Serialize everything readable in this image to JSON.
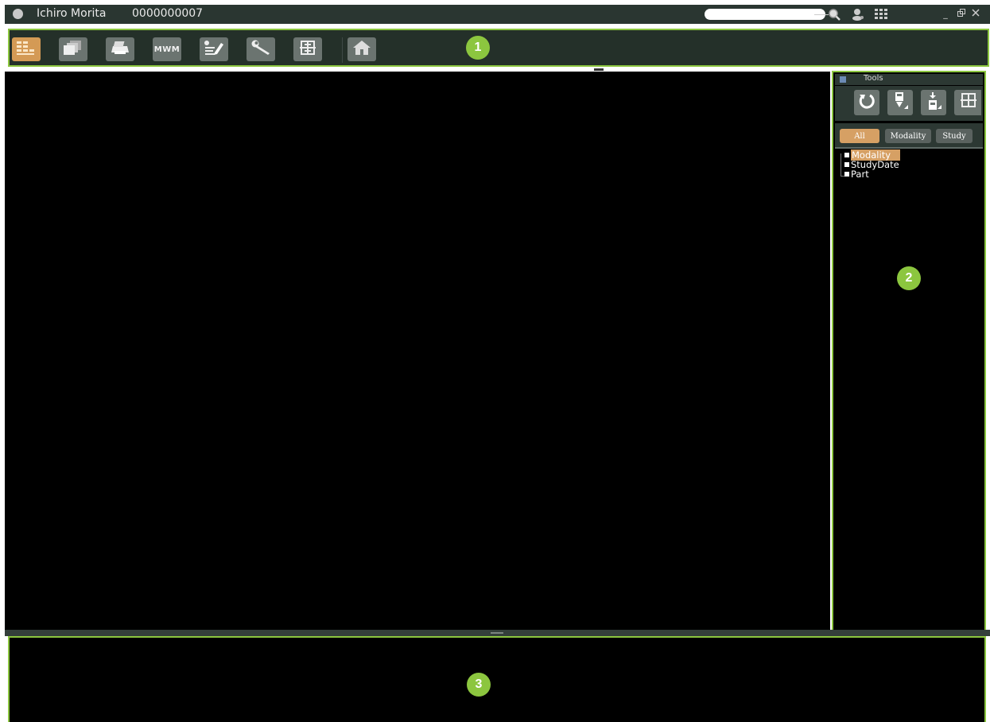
{
  "titlebar": {
    "patient_name": "Ichiro Morita",
    "patient_id": "0000000007",
    "search_value": "",
    "icons": [
      "avatar-icon",
      "search-icon",
      "user-search-icon",
      "grid-icon",
      "minimize-icon",
      "restore-icon",
      "close-icon"
    ]
  },
  "toolbar": {
    "buttons": [
      {
        "name": "thumbnail-view-button",
        "icon": "grid-icon",
        "active": true
      },
      {
        "name": "series-view-button",
        "icon": "stack-icon"
      },
      {
        "name": "print-button",
        "icon": "printer-icon"
      },
      {
        "name": "mwm-button",
        "label": "MWM"
      },
      {
        "name": "report-button",
        "icon": "edit-notes-icon"
      },
      {
        "name": "settings-button",
        "icon": "wrench-icon"
      },
      {
        "name": "layout-button",
        "icon": "layout-icon"
      },
      {
        "name": "home-button",
        "icon": "home-icon"
      }
    ]
  },
  "callouts": {
    "c1": "1",
    "c2": "2",
    "c3": "3"
  },
  "tools_panel": {
    "title": "Tools",
    "tool_icons": [
      "refresh-icon",
      "download-icon",
      "import-icon",
      "layout-icon"
    ],
    "filters": {
      "all": "All",
      "modality": "Modality",
      "study": "Study"
    },
    "tree": [
      "Modality",
      "StudyDate",
      "Part"
    ]
  },
  "colors": {
    "accent": "#8cc63f",
    "active": "#d6a064",
    "chrome": "#2c3833"
  }
}
